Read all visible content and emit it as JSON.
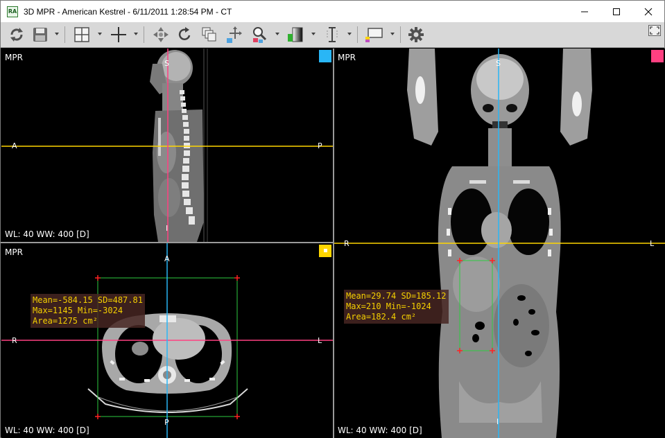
{
  "window": {
    "title": "3D MPR - American Kestrel - 6/11/2011 1:28:54 PM - CT",
    "app_icon_text": "RA"
  },
  "toolbar": {
    "icons": [
      "refresh-icon",
      "save-icon",
      "layout-icon",
      "crosshair-icon",
      "pan-icon",
      "rotate-icon",
      "stack-icon",
      "move-icon",
      "zoom-icon",
      "window-level-icon",
      "thickness-icon",
      "overlay-icon",
      "settings-icon",
      "fullscreen-icon"
    ]
  },
  "colors": {
    "sagittal_marker": "#29b6f6",
    "coronal_marker": "#ff4081",
    "axial_marker": "#ffd600",
    "axial_line": "#ff4081",
    "coronal_line": "#29b6f6",
    "sagittal_line": "#ffd600",
    "roi_outline": "#2ecc40",
    "roi_corner": "#ff2222",
    "stats_text": "#f5d000"
  },
  "viewports": {
    "sagittal": {
      "label": "MPR",
      "wl": "WL: 40 WW: 400 [D]",
      "orient_top": "S",
      "orient_bottom": "I",
      "orient_left": "A",
      "orient_right": "P"
    },
    "coronal": {
      "label": "MPR",
      "wl": "WL: 40 WW: 400 [D]",
      "orient_top": "S",
      "orient_bottom": "I",
      "orient_left": "R",
      "orient_right": "L",
      "stats": {
        "line1": "Mean=29.74 SD=185.12",
        "line2": "Max=210 Min=-1024",
        "line3": "Area=182.4 cm²"
      }
    },
    "axial": {
      "label": "MPR",
      "wl": "WL: 40 WW: 400 [D]",
      "orient_top": "A",
      "orient_bottom": "P",
      "orient_left": "R",
      "orient_right": "L",
      "stats": {
        "line1": "Mean=-584.15 SD=487.81",
        "line2": "Max=1145 Min=-3024",
        "line3": "Area=1275 cm²"
      }
    }
  }
}
